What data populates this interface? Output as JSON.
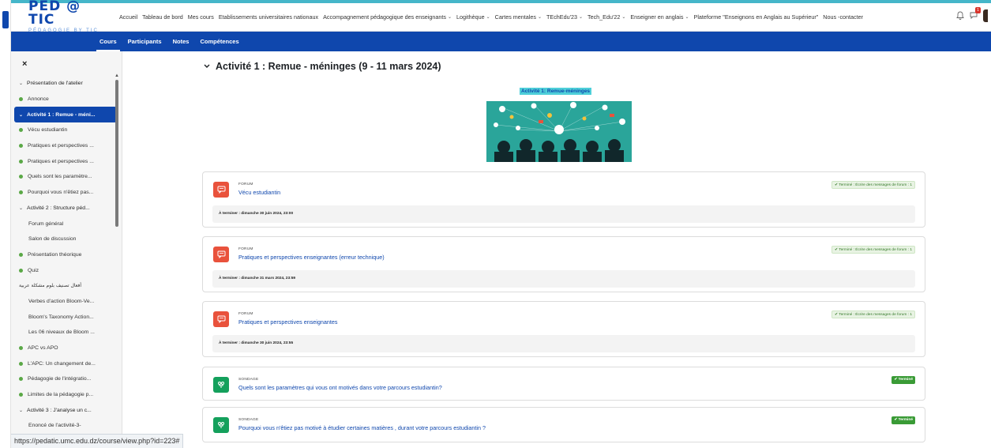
{
  "logo": {
    "main": "PED @ TIC",
    "sub": "PÉDAGOGIE BY TIC"
  },
  "menu": [
    {
      "label": "Accueil",
      "dropdown": false
    },
    {
      "label": "Tableau de bord",
      "dropdown": false
    },
    {
      "label": "Mes cours",
      "dropdown": false
    },
    {
      "label": "Etablissements universitaires nationaux",
      "dropdown": false
    },
    {
      "label": "Accompagnement pédagogique des enseignants",
      "dropdown": true
    },
    {
      "label": "Logithèque",
      "dropdown": true
    },
    {
      "label": "Cartes mentales",
      "dropdown": true
    },
    {
      "label": "TEchEdu'23",
      "dropdown": true
    },
    {
      "label": "Tech_Edu'22",
      "dropdown": true
    },
    {
      "label": "Enseigner en anglais",
      "dropdown": true
    },
    {
      "label": "Plateforme \"Enseignons en Anglais au Supérieur\"",
      "dropdown": false
    },
    {
      "label": "Nous -contacter",
      "dropdown": false
    }
  ],
  "notifications": {
    "badge": "1"
  },
  "subnav": [
    "Cours",
    "Participants",
    "Notes",
    "Compétences"
  ],
  "drawer": {
    "close": "×",
    "items": [
      {
        "label": "Présentation de l'atelier",
        "kind": "section"
      },
      {
        "label": "Annonce",
        "kind": "done"
      },
      {
        "label": "Activité 1 : Remue - méni...",
        "kind": "section-active"
      },
      {
        "label": "Vécu estudiantin",
        "kind": "done"
      },
      {
        "label": "Pratiques et perspectives ...",
        "kind": "done"
      },
      {
        "label": "Pratiques et perspectives ...",
        "kind": "done"
      },
      {
        "label": "Quels sont les paramètre...",
        "kind": "done"
      },
      {
        "label": "Pourquoi vous n'êtiez pas...",
        "kind": "done"
      },
      {
        "label": "Activité 2 : Structure péd...",
        "kind": "section"
      },
      {
        "label": "Forum général",
        "kind": "plain"
      },
      {
        "label": "Salon de discussion",
        "kind": "plain"
      },
      {
        "label": "Présentation théorique",
        "kind": "done"
      },
      {
        "label": "Quiz",
        "kind": "done"
      },
      {
        "label": "أفعال تصنيف بلوم مشكلة عربية",
        "kind": "arabic"
      },
      {
        "label": "Verbes d'action Bloom-Ve...",
        "kind": "plain"
      },
      {
        "label": "Bloom's Taxonomy Action...",
        "kind": "plain"
      },
      {
        "label": "Les 06 niveaux de Bloom ...",
        "kind": "plain"
      },
      {
        "label": "APC vs APO",
        "kind": "done"
      },
      {
        "label": "L'APC: Un changement de...",
        "kind": "done"
      },
      {
        "label": "Pédagogie de l'intégratio...",
        "kind": "done"
      },
      {
        "label": "Limites de la pédagogie p...",
        "kind": "done"
      },
      {
        "label": "Activité 3 : J'analyse un c...",
        "kind": "section"
      },
      {
        "label": "Enoncé de l'activité-3-",
        "kind": "plain"
      }
    ]
  },
  "section": {
    "title": "Activité 1 : Remue - méninges (9 - 11 mars 2024)",
    "image_caption": "Activité 1: Remue-méninges"
  },
  "activities": [
    {
      "type": "FORUM",
      "name": "Vécu estudiantin",
      "status": "✔ Terminé : Écrire des messages de forum : 1",
      "due": "À terminer : dimanche 30 juin 2024, 23:00",
      "kind": "forum"
    },
    {
      "type": "FORUM",
      "name": "Pratiques et perspectives enseignantes (erreur technique)",
      "status": "✔ Terminé : Écrire des messages de forum : 1",
      "due": "À terminer : dimanche 31 mars 2024, 23:59",
      "kind": "forum"
    },
    {
      "type": "FORUM",
      "name": "Pratiques et perspectives enseignantes",
      "status": "✔ Terminé : Écrire des messages de forum : 1",
      "due": "À terminer : dimanche 30 juin 2024, 23:55",
      "kind": "forum"
    },
    {
      "type": "SONDAGE",
      "name": "Quels sont les paramètres qui vous ont motivés dans votre parcours estudiantin?",
      "status": "✔ Terminé",
      "due": "",
      "kind": "survey"
    },
    {
      "type": "SONDAGE",
      "name": "Pourquoi vous n'êtiez pas motivé à étudier certaines matières , durant votre parcours estudiantin ?",
      "status": "✔ Terminé",
      "due": "",
      "kind": "survey"
    }
  ],
  "statusbar": {
    "url": "https://pedatic.umc.edu.dz/course/view.php?id=223#"
  },
  "colors": {
    "brand": "#0f47ad",
    "accent": "#45b6c9",
    "forum": "#e9523c",
    "survey": "#14a05c",
    "done": "#3a9b36"
  }
}
